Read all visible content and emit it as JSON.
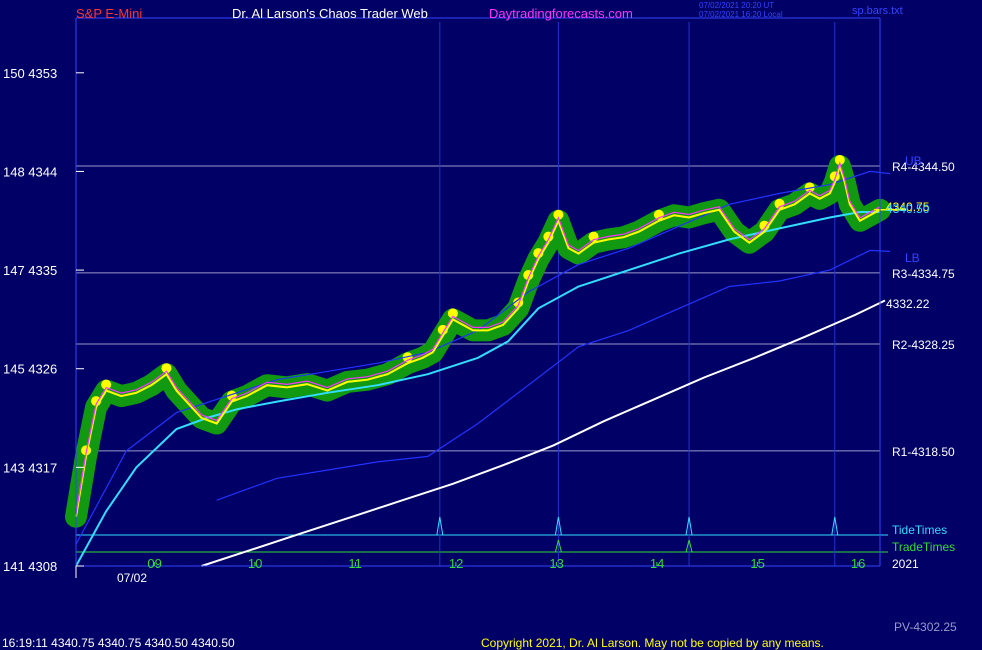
{
  "header": {
    "instrument": "S&P E-Mini",
    "site_title": "Dr. Al Larson's Chaos Trader Web",
    "site_url": "Daytradingforecasts.com",
    "time_utc": "07/02/2021 20:20 UT",
    "time_local": "07/02/2021 16:20 Local",
    "file": "sp.bars.txt"
  },
  "footer": {
    "quote": "16:19:11  4340.75 4340.75 4340.50 4340.50",
    "copyright": "Copyright 2021, Dr. Al Larson. May not be copied by any means.",
    "pv": "PV-4302.25"
  },
  "colors": {
    "background": "#000066",
    "price": "#ff33ff",
    "smooth": "#ffff00",
    "band_green": "#119911",
    "band_dot": "#ffff00",
    "ema_fast": "#33ddff",
    "ema_slow": "#ffffff",
    "channel": "#2233ff",
    "level_line": "#9999cc",
    "tide": "#33ddff",
    "trade": "#33dd33"
  },
  "chart_data": {
    "type": "line",
    "ylim": [
      4308,
      4358
    ],
    "y_ticks": [
      {
        "left": "150",
        "price": "4353",
        "value": 4353
      },
      {
        "left": "148",
        "price": "4344",
        "value": 4344
      },
      {
        "left": "147",
        "price": "4335",
        "value": 4335
      },
      {
        "left": "145",
        "price": "4326",
        "value": 4326
      },
      {
        "left": "143",
        "price": "4317",
        "value": 4317
      },
      {
        "left": "141",
        "price": "4308",
        "value": 4308
      }
    ],
    "xlim": [
      8.0,
      16.0
    ],
    "x_ticks": [
      {
        "label": "09",
        "value": 8.78
      },
      {
        "label": "10",
        "value": 9.78
      },
      {
        "label": "11",
        "value": 10.78
      },
      {
        "label": "12",
        "value": 11.78
      },
      {
        "label": "13",
        "value": 12.78
      },
      {
        "label": "14",
        "value": 13.78
      },
      {
        "label": "15",
        "value": 14.78
      },
      {
        "label": "16",
        "value": 15.78
      }
    ],
    "date_label": "07/02",
    "year_label": "2021",
    "levels": [
      {
        "label": "R4-4344.50",
        "value": 4344.5
      },
      {
        "label": "R3-4334.75",
        "value": 4334.75
      },
      {
        "label": "R2-4328.25",
        "value": 4328.25
      },
      {
        "label": "R1-4318.50",
        "value": 4318.5
      }
    ],
    "channel_labels": {
      "upper": "UB",
      "lower": "LB"
    },
    "last_price_label": "4340.50",
    "last_price_label_2": "4340.75",
    "slow_label": "4332.22",
    "tide_label": "TideTimes",
    "trade_label": "TradeTimes",
    "tide_times": [
      11.62,
      12.8,
      14.1,
      15.55
    ],
    "trade_times": [
      12.8,
      14.1
    ],
    "series": [
      {
        "name": "price",
        "x": [
          8.0,
          8.1,
          8.2,
          8.3,
          8.45,
          8.6,
          8.75,
          8.9,
          9.0,
          9.1,
          9.25,
          9.4,
          9.55,
          9.7,
          9.8,
          9.9,
          10.1,
          10.3,
          10.5,
          10.7,
          10.9,
          11.1,
          11.3,
          11.45,
          11.55,
          11.65,
          11.75,
          11.85,
          11.95,
          12.1,
          12.25,
          12.4,
          12.5,
          12.6,
          12.7,
          12.8,
          12.9,
          13.0,
          13.15,
          13.3,
          13.45,
          13.6,
          13.8,
          13.95,
          14.1,
          14.25,
          14.4,
          14.55,
          14.7,
          14.85,
          15.0,
          15.15,
          15.3,
          15.4,
          15.5,
          15.55,
          15.6,
          15.65,
          15.7,
          15.8,
          15.9,
          16.0
        ],
        "values": [
          4312.5,
          4318.0,
          4322.5,
          4324.0,
          4323.5,
          4323.8,
          4324.5,
          4325.5,
          4324.0,
          4323.0,
          4321.5,
          4321.0,
          4323.0,
          4323.5,
          4324.0,
          4324.5,
          4324.3,
          4324.6,
          4324.0,
          4324.8,
          4325.0,
          4325.5,
          4326.5,
          4327.0,
          4327.5,
          4329.0,
          4330.5,
          4330.0,
          4329.5,
          4329.5,
          4330.0,
          4331.5,
          4334.0,
          4336.0,
          4337.5,
          4339.5,
          4337.0,
          4336.5,
          4337.5,
          4337.8,
          4338.0,
          4338.5,
          4339.5,
          4340.0,
          4339.8,
          4340.2,
          4340.5,
          4338.5,
          4337.5,
          4338.5,
          4340.5,
          4341.0,
          4342.0,
          4341.5,
          4342.0,
          4343.0,
          4344.5,
          4343.0,
          4341.0,
          4339.5,
          4340.0,
          4340.5
        ]
      },
      {
        "name": "ema_fast",
        "x": [
          8.0,
          8.3,
          8.6,
          9.0,
          9.3,
          9.6,
          10.0,
          10.5,
          11.0,
          11.5,
          12.0,
          12.3,
          12.6,
          13.0,
          13.5,
          14.0,
          14.5,
          15.0,
          15.5,
          15.8,
          16.0
        ],
        "values": [
          4308.0,
          4313.0,
          4317.0,
          4320.5,
          4321.5,
          4322.3,
          4323.0,
          4323.8,
          4324.5,
          4325.5,
          4327.0,
          4328.5,
          4331.5,
          4333.5,
          4335.0,
          4336.5,
          4337.8,
          4338.8,
          4339.8,
          4340.3,
          4340.3
        ]
      },
      {
        "name": "ema_slow",
        "x": [
          9.25,
          9.75,
          10.25,
          10.75,
          11.25,
          11.75,
          12.25,
          12.75,
          13.25,
          13.75,
          14.25,
          14.75,
          15.25,
          15.75,
          16.05
        ],
        "values": [
          4308.0,
          4309.5,
          4311.0,
          4312.5,
          4314.0,
          4315.5,
          4317.2,
          4319.0,
          4321.2,
          4323.2,
          4325.2,
          4327.0,
          4328.9,
          4330.9,
          4332.22
        ]
      },
      {
        "name": "channel_upper",
        "x": [
          8.0,
          8.5,
          9.0,
          10.0,
          11.0,
          11.5,
          12.0,
          12.5,
          13.0,
          13.5,
          14.0,
          14.5,
          15.0,
          15.5,
          15.9,
          16.1
        ],
        "values": [
          4310.0,
          4318.5,
          4322.0,
          4325.0,
          4326.5,
          4327.5,
          4329.5,
          4333.0,
          4335.5,
          4337.0,
          4339.0,
          4341.0,
          4342.0,
          4342.8,
          4344.0,
          4343.8
        ]
      },
      {
        "name": "channel_lower",
        "x": [
          9.4,
          10.0,
          11.0,
          11.5,
          12.0,
          12.5,
          13.0,
          13.5,
          14.0,
          14.5,
          15.0,
          15.5,
          15.9,
          16.1
        ],
        "values": [
          4314.0,
          4316.0,
          4317.5,
          4318.0,
          4321.0,
          4324.5,
          4328.0,
          4329.5,
          4331.5,
          4333.5,
          4334.0,
          4335.0,
          4336.8,
          4336.7
        ]
      }
    ]
  }
}
